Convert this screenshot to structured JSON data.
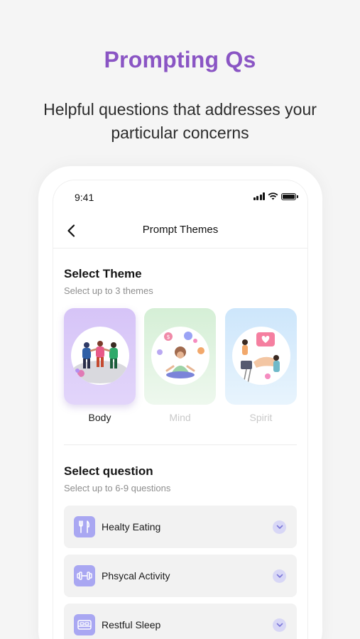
{
  "hero": {
    "title": "Prompting Qs",
    "subtitle": "Helpful questions that addresses your particular concerns"
  },
  "status_bar": {
    "time": "9:41"
  },
  "nav": {
    "title": "Prompt Themes"
  },
  "theme_section": {
    "title": "Select Theme",
    "subtitle": "Select up to 3 themes",
    "themes": [
      {
        "label": "Body",
        "selected": true
      },
      {
        "label": "Mind",
        "selected": false
      },
      {
        "label": "Spirit",
        "selected": false
      }
    ]
  },
  "question_section": {
    "title": "Select question",
    "subtitle": "Select up to 6-9 questions",
    "items": [
      {
        "label": "Healty Eating",
        "icon": "utensils-icon"
      },
      {
        "label": "Phsycal Activity",
        "icon": "dumbbell-icon"
      },
      {
        "label": "Restful Sleep",
        "icon": "bed-icon"
      }
    ]
  },
  "colors": {
    "accent": "#8a55c4",
    "icon_tile": "#a9a7f2",
    "body_card": "#d9c9f5",
    "mind_card": "#dcf0dc",
    "spirit_card": "#d3eaf9"
  }
}
